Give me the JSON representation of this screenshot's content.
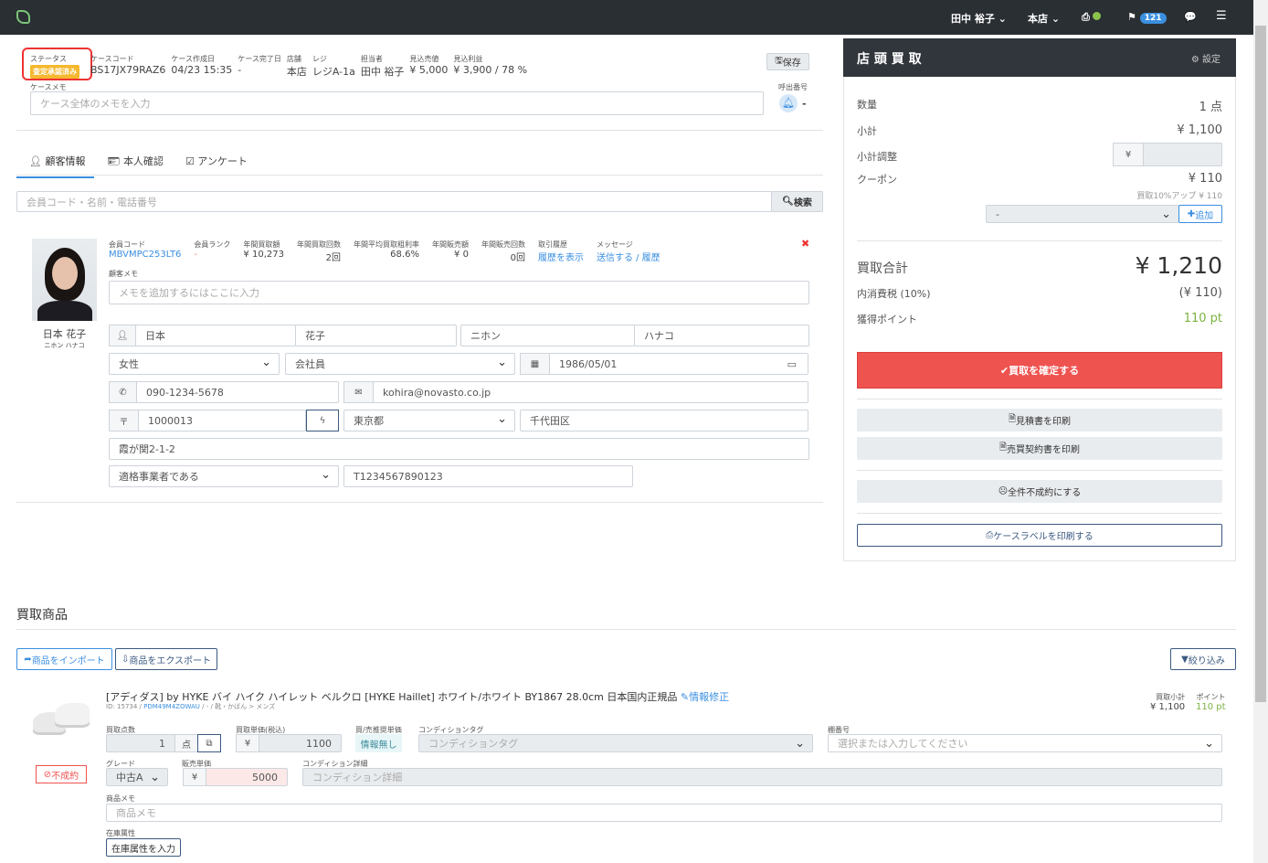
{
  "nav": {
    "user": "田中 裕子",
    "store": "本店",
    "notifications": "121"
  },
  "case": {
    "status_label": "ステータス",
    "status": "査定承認済み",
    "fields": [
      {
        "label": "ケースコード",
        "value": "BS17JX79RAZ6"
      },
      {
        "label": "ケース作成日",
        "value": "04/23 15:35"
      },
      {
        "label": "ケース完了日",
        "value": "-"
      },
      {
        "label": "店舗",
        "value": "本店"
      },
      {
        "label": "レジ",
        "value": "レジA-1a"
      },
      {
        "label": "担当者",
        "value": "田中 裕子"
      },
      {
        "label": "見込売値",
        "value": "¥ 5,000"
      },
      {
        "label": "見込利益",
        "value": "¥ 3,900 / 78 %"
      }
    ],
    "save": "保存",
    "memo_label": "ケースメモ",
    "memo_placeholder": "ケース全体のメモを入力",
    "call_label": "呼出番号",
    "call_value": "-"
  },
  "tabs": [
    "顧客情報",
    "本人確認",
    "アンケート"
  ],
  "search": {
    "placeholder": "会員コード・名前・電話番号",
    "button": "検索"
  },
  "customer": {
    "name": "日本 花子",
    "kana": "ニホン ハナコ",
    "stats": [
      {
        "label": "会員コード",
        "value": "MBVMPC253LT6"
      },
      {
        "label": "会員ランク",
        "value": "-"
      },
      {
        "label": "年間買取額",
        "value": "¥ 10,273"
      },
      {
        "label": "年間買取回数",
        "value": "2回"
      },
      {
        "label": "年間平均買取粗利率",
        "value": "68.6%"
      },
      {
        "label": "年間販売額",
        "value": "¥ 0"
      },
      {
        "label": "年間販売回数",
        "value": "0回"
      },
      {
        "label": "取引履歴",
        "value": "履歴を表示"
      },
      {
        "label": "メッセージ",
        "value": "送信する / 履歴"
      }
    ],
    "memo_label": "顧客メモ",
    "memo_placeholder": "メモを追加するにはここに入力",
    "last_name": "日本",
    "first_name": "花子",
    "last_kana": "ニホン",
    "first_kana": "ハナコ",
    "gender": "女性",
    "job": "会社員",
    "birthday": "1986/05/01",
    "phone": "090-1234-5678",
    "email": "kohira@novasto.co.jp",
    "zip": "1000013",
    "pref": "東京都",
    "city": "千代田区",
    "address": "霞が関2-1-2",
    "invoice_type": "適格事業者である",
    "invoice_no": "T1234567890123"
  },
  "summary": {
    "title": "店 頭 買 取",
    "settings": "設定",
    "qty_label": "数量",
    "qty": "1 点",
    "subtotal_label": "小計",
    "subtotal": "¥ 1,100",
    "adjust_label": "小計調整",
    "yen": "¥",
    "coupon_label": "クーポン",
    "coupon": "¥ 110",
    "coupon_detail": "買取10%アップ ¥ 110",
    "coupon_select": "-",
    "add": "追加",
    "total_label": "買取合計",
    "total": "¥ 1,210",
    "tax_label": "内消費税 (10%)",
    "tax": "(¥ 110)",
    "points_label": "獲得ポイント",
    "points": "110 pt",
    "confirm": "買取を確定する",
    "print_estimate": "見積書を印刷",
    "print_contract": "売買契約書を印刷",
    "reject_all": "全件不成約にする",
    "print_label": "ケースラベルを印刷する"
  },
  "items_section": {
    "title": "買取商品",
    "import": "商品をインポート",
    "export": "商品をエクスポート",
    "filter": "絞り込み"
  },
  "item": {
    "title": "[アディダス] by HYKE バイ ハイク ハイレット ベルクロ [HYKE Haillet] ホワイト/ホワイト BY1867 28.0cm 日本国内正規品",
    "edit": "情報修正",
    "id": "ID: 15734 /",
    "code": "PDM49M4ZOWAU",
    "category": "/ - / 靴・かばん > メンズ",
    "subtotal_label": "買取小計",
    "subtotal": "¥ 1,100",
    "points_label": "ポイント",
    "points": "110 pt",
    "qty_label": "買取点数",
    "qty": "1",
    "unit": "点",
    "price_label": "買取単価(税込)",
    "price": "1100",
    "rec_label": "買/売推奨単価",
    "rec": "情報無し",
    "tag_label": "コンディションタグ",
    "tag_placeholder": "コンディションタグ",
    "shelf_label": "棚番号",
    "shelf_placeholder": "選択または入力してください",
    "grade_label": "グレード",
    "grade": "中古A",
    "sale_label": "販売単価",
    "sale": "5000",
    "cond_label": "コンディション詳細",
    "cond_placeholder": "コンディション詳細",
    "memo_label": "商品メモ",
    "memo_placeholder": "商品メモ",
    "stock_label": "在庫属性",
    "stock_button": "在庫属性を入力",
    "reject": "不成約"
  }
}
